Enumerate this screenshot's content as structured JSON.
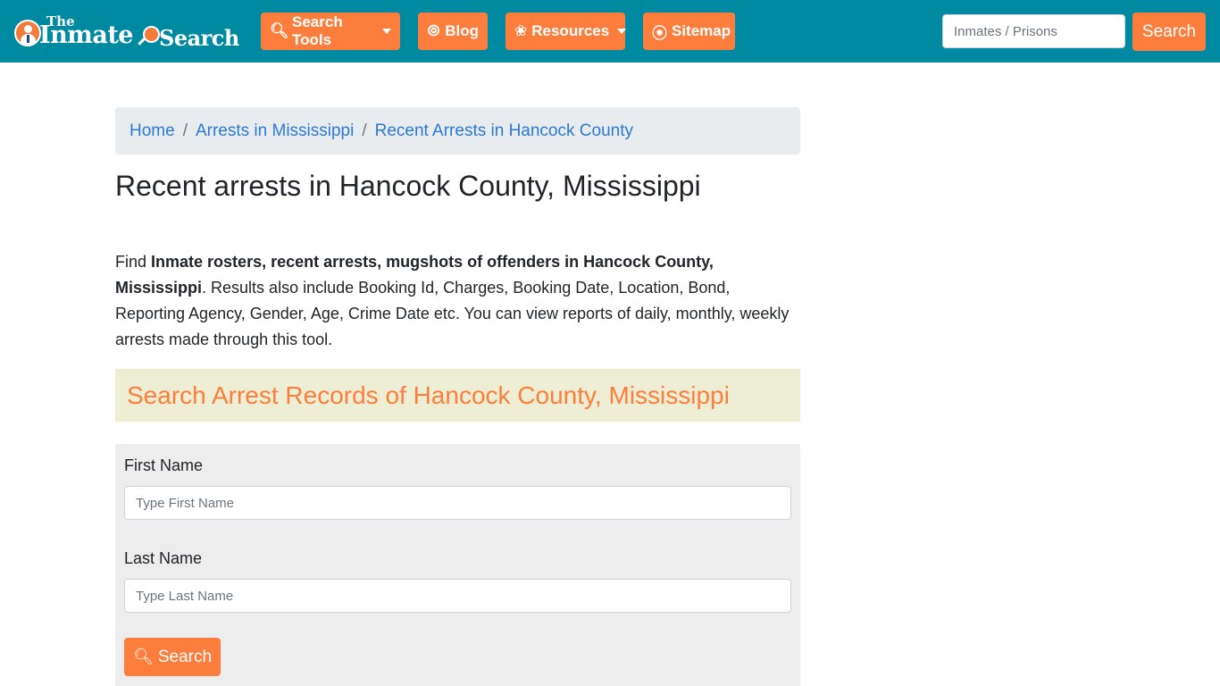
{
  "brand": {
    "the": "The",
    "inmate": "Inmate",
    "search": "Search",
    "colors": {
      "navbar": "#008aa2",
      "accent": "#fd7e3c",
      "link": "#2b7ad6"
    }
  },
  "nav": {
    "search_tools": {
      "label": "Search Tools",
      "icon": "search-icon"
    },
    "blog": {
      "label": "Blog",
      "icon": "blogger-icon"
    },
    "resources": {
      "label": "Resources",
      "icon": "leaf-icon"
    },
    "sitemap": {
      "label": "Sitemap",
      "icon": "rss-icon"
    }
  },
  "top_search": {
    "placeholder": "Inmates / Prisons",
    "button_label": "Search"
  },
  "breadcrumb": [
    {
      "label": "Home"
    },
    {
      "label": "Arrests in Mississippi"
    },
    {
      "label": "Recent Arrests in Hancock County"
    }
  ],
  "breadcrumb_separator": "/",
  "page_title": "Recent arrests in Hancock County, Mississippi",
  "intro": {
    "prefix": "Find ",
    "bold": "Inmate rosters, recent arrests, mugshots of offenders in Hancock County, Mississippi",
    "suffix": ". Results also include Booking Id, Charges, Booking Date, Location, Bond, Reporting Agency, Gender, Age, Crime Date etc. You can view reports of daily, monthly, weekly arrests made through this tool."
  },
  "search_section": {
    "heading": "Search Arrest Records of Hancock County, Mississippi",
    "first_name_label": "First Name",
    "first_name_placeholder": "Type First Name",
    "first_name_value": "",
    "last_name_label": "Last Name",
    "last_name_placeholder": "Type Last Name",
    "last_name_value": "",
    "button_label": "Search"
  }
}
